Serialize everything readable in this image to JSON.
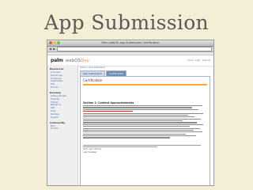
{
  "slide": {
    "title": "App Submission"
  },
  "browser": {
    "window_title": "Palm webOS App Submission Certification",
    "toolbar": {
      "back": "◀",
      "forward": "▶"
    },
    "colors": {
      "close": "#ec5f57",
      "minimize": "#f4bf4f",
      "zoom": "#62c655"
    }
  },
  "site": {
    "logo_brand": "palm",
    "logo_product_prefix": "webOS",
    "logo_product_suffix": "Dev",
    "top_links": [
      "Home",
      "Login",
      "Support"
    ],
    "accent_color": "#f4a73a"
  },
  "sidebar": {
    "sections": [
      {
        "heading": "Resources",
        "items": [
          "Overview",
          "Submit App",
          "Guidelines",
          "Certification",
          "FAQ",
          "Forums"
        ]
      },
      {
        "heading": "Develop",
        "items": [
          "Getting Started",
          "Tutorials",
          "Articles",
          "Reference",
          "SDK",
          "Tools",
          "Samples",
          "Support"
        ]
      },
      {
        "heading": "Community",
        "items": [
          "Blog",
          "Forums"
        ]
      }
    ]
  },
  "main": {
    "breadcrumb": "Home > App Submission",
    "tabs": [
      "App Submission",
      "Certification"
    ],
    "active_tab": 1,
    "panel_title": "Certification",
    "section_title": "Section 1: Content Appropriateness",
    "note_link": "Palm App Catalog",
    "last_updated": "Last Updated"
  }
}
